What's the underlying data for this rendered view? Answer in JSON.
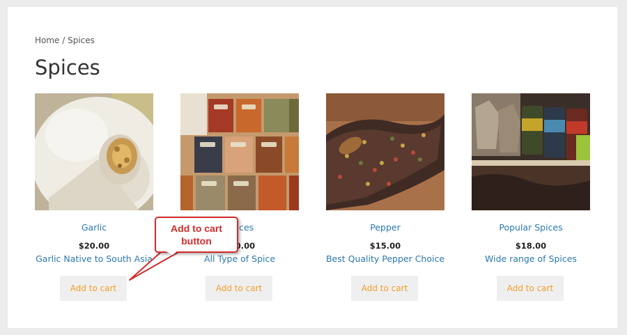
{
  "breadcrumb": {
    "home": "Home",
    "separator": " / ",
    "current": "Spices"
  },
  "page": {
    "title": "Spices"
  },
  "products": [
    {
      "name": "Garlic",
      "price": "$20.00",
      "description": "Garlic Native to South Asia",
      "button": "Add to cart",
      "image": "garlic-photo"
    },
    {
      "name": "Spices",
      "price": "$20.00",
      "description": "All Type of Spice",
      "button": "Add to cart",
      "image": "spice-boxes-photo"
    },
    {
      "name": "Pepper",
      "price": "$15.00",
      "description": "Best Quality Pepper Choice",
      "button": "Add to cart",
      "image": "peppercorns-photo"
    },
    {
      "name": "Popular Spices",
      "price": "$18.00",
      "description": "Wide range of Spices",
      "button": "Add to cart",
      "image": "spice-jars-photo"
    }
  ],
  "annotation": {
    "line1": "Add to cart",
    "line2": "button"
  },
  "colors": {
    "link": "#2a78b0",
    "button_text": "#f0a02a",
    "button_bg": "#efefef",
    "callout": "#d22b2b"
  }
}
